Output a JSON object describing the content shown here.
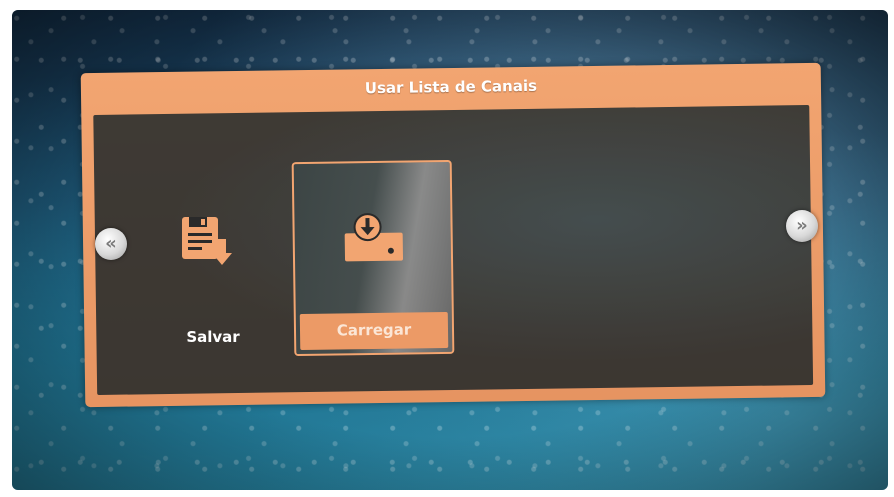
{
  "dialog": {
    "title": "Usar Lista de Canais"
  },
  "items": [
    {
      "label": "Salvar",
      "icon": "floppy-save-icon",
      "selected": false
    },
    {
      "label": "Carregar",
      "icon": "download-load-icon",
      "selected": true
    }
  ],
  "nav": {
    "prev_icon": "«",
    "next_icon": "»"
  },
  "colors": {
    "accent": "#f2a571",
    "panel": "#0c1c24"
  }
}
